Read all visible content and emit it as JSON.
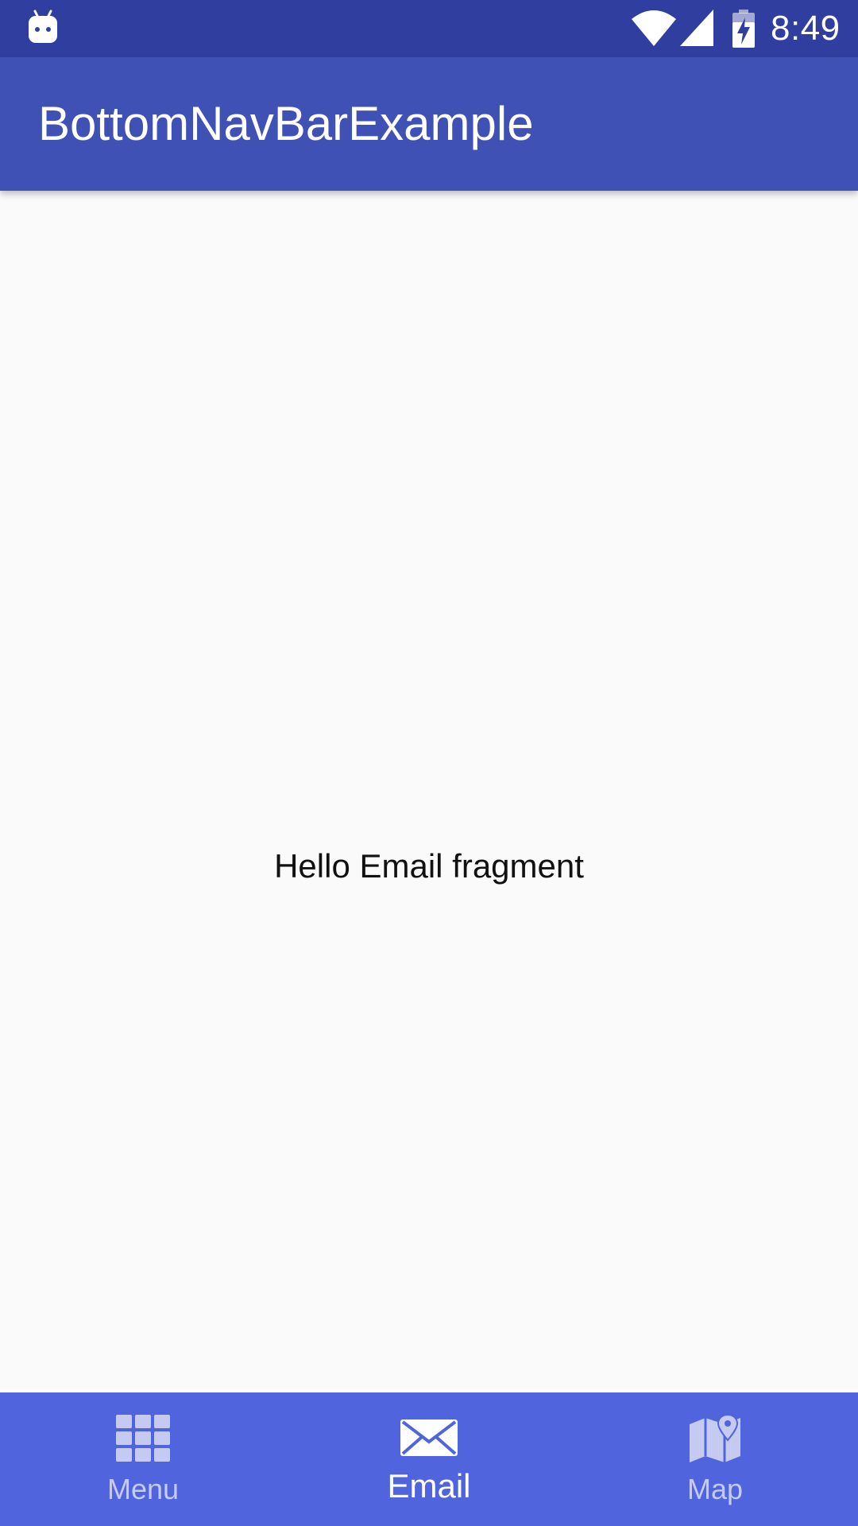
{
  "status_bar": {
    "time": "8:49",
    "icons": [
      "android-icon",
      "wifi-icon",
      "signal-icon",
      "battery-charging-icon"
    ],
    "background_color": "#303f9f"
  },
  "app_bar": {
    "title": "BottomNavBarExample",
    "background_color": "#3f51b5"
  },
  "content": {
    "message": "Hello Email fragment"
  },
  "bottom_nav": {
    "background_color": "#5065dd",
    "items": [
      {
        "label": "Menu",
        "icon": "grid-menu-icon",
        "active": false
      },
      {
        "label": "Email",
        "icon": "envelope-icon",
        "active": true
      },
      {
        "label": "Map",
        "icon": "map-icon",
        "active": false
      }
    ]
  }
}
